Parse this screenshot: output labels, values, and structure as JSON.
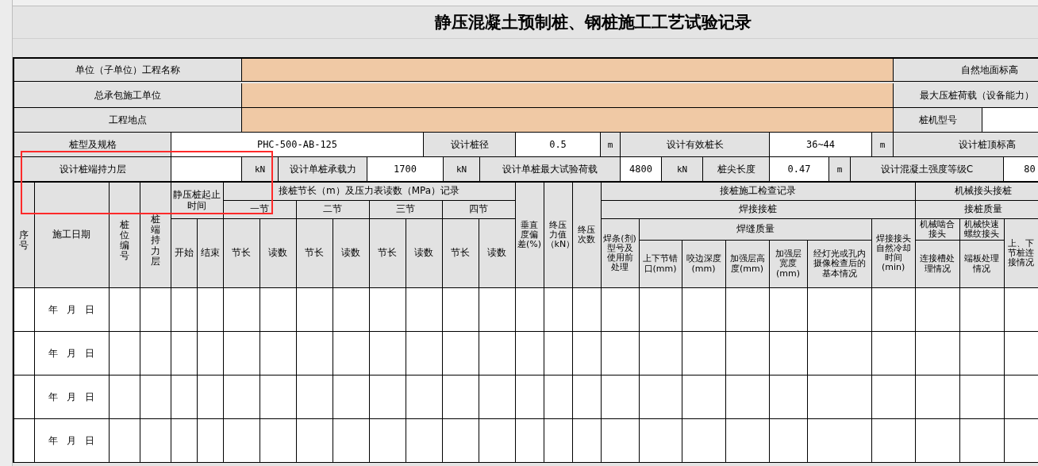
{
  "title": "静压混凝土预制桩、钢桩施工工艺试验记录",
  "info_rows": [
    [
      {
        "kind": "label",
        "text": "单位（子单位）工程名称"
      },
      {
        "kind": "input"
      },
      {
        "kind": "label",
        "text": "自然地面标高"
      }
    ],
    [
      {
        "kind": "label",
        "text": "总承包施工单位"
      },
      {
        "kind": "input"
      },
      {
        "kind": "label",
        "text": "最大压桩荷载（设备能力）"
      }
    ],
    [
      {
        "kind": "label",
        "text": "工程地点"
      },
      {
        "kind": "input"
      },
      {
        "kind": "label",
        "text": "桩机型号"
      },
      {
        "kind": "value"
      }
    ],
    [
      {
        "kind": "label",
        "text": "桩型及规格"
      },
      {
        "kind": "value",
        "text": "PHC-500-AB-125"
      },
      {
        "kind": "label",
        "text": "设计桩径"
      },
      {
        "kind": "value",
        "text": "0.5"
      },
      {
        "kind": "unit",
        "text": "m"
      },
      {
        "kind": "label",
        "text": "设计有效桩长"
      },
      {
        "kind": "value",
        "text": "36~44"
      },
      {
        "kind": "unit",
        "text": "m"
      },
      {
        "kind": "label",
        "text": "设计桩顶标高"
      }
    ],
    [
      {
        "kind": "label",
        "text": "设计桩端持力层"
      },
      {
        "kind": "value"
      },
      {
        "kind": "unit",
        "text": "kN"
      },
      {
        "kind": "label",
        "text": "设计单桩承载力"
      },
      {
        "kind": "value",
        "text": "1700"
      },
      {
        "kind": "unit",
        "text": "kN"
      },
      {
        "kind": "label",
        "text": "设计单桩最大试验荷载"
      },
      {
        "kind": "value",
        "text": "4800"
      },
      {
        "kind": "unit",
        "text": "kN"
      },
      {
        "kind": "label",
        "text": "桩尖长度"
      },
      {
        "kind": "value",
        "text": "0.47"
      },
      {
        "kind": "unit",
        "text": "m"
      },
      {
        "kind": "label",
        "text": "设计混凝土强度等级C"
      },
      {
        "kind": "value",
        "text": "80"
      }
    ]
  ],
  "header_rows": [
    [
      "序号",
      "施工日期",
      "桩位编号",
      "桩端持力层",
      "静压桩起止时间",
      "接桩节长（m）及压力表读数（MPa）记录",
      "垂直度偏差(%)",
      "终压力值（kN）",
      "终压次数",
      "接桩施工检查记录",
      "机械接头接桩"
    ],
    [
      "一节",
      "二节",
      "三节",
      "四节",
      "焊接接桩",
      "接桩质量"
    ],
    [
      "开始",
      "结束",
      "节长",
      "读数",
      "节长",
      "读数",
      "节长",
      "读数",
      "节长",
      "读数",
      "焊条(剂)型号及使用前处理",
      "焊缝质量",
      "焊接接头自然冷却时间(min)",
      "机械啮合接头",
      "机械快速螺纹接头",
      "上、下节桩连接情况"
    ],
    [
      "上下节错口(mm)",
      "咬边深度(mm)",
      "加强层高度(mm)",
      "加强层宽度(mm)",
      "经灯光或孔内摄像检查后的基本情况",
      "连接槽处理情况",
      "端板处理情况"
    ]
  ],
  "rows": [
    {
      "date": "年   月   日"
    },
    {
      "date": "年   月   日"
    },
    {
      "date": "年   月   日"
    },
    {
      "date": "年   月   日"
    }
  ]
}
